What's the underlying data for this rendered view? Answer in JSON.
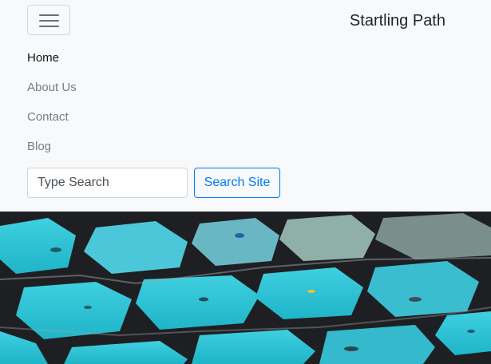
{
  "navbar": {
    "brand": "Startling Path",
    "toggler_icon": "hamburger-menu-icon",
    "items": [
      {
        "label": "Home",
        "active": true
      },
      {
        "label": "About Us",
        "active": false
      },
      {
        "label": "Contact",
        "active": false
      },
      {
        "label": "Blog",
        "active": false
      }
    ],
    "search": {
      "placeholder": "Type Search",
      "value": "",
      "button_label": "Search Site"
    }
  },
  "colors": {
    "navbar_bg": "#f8f9fa",
    "link_active": "#111111",
    "link_muted": "#7a7d80",
    "primary": "#007bff",
    "water": "#2ec4d6",
    "frame": "#1e1f22"
  }
}
